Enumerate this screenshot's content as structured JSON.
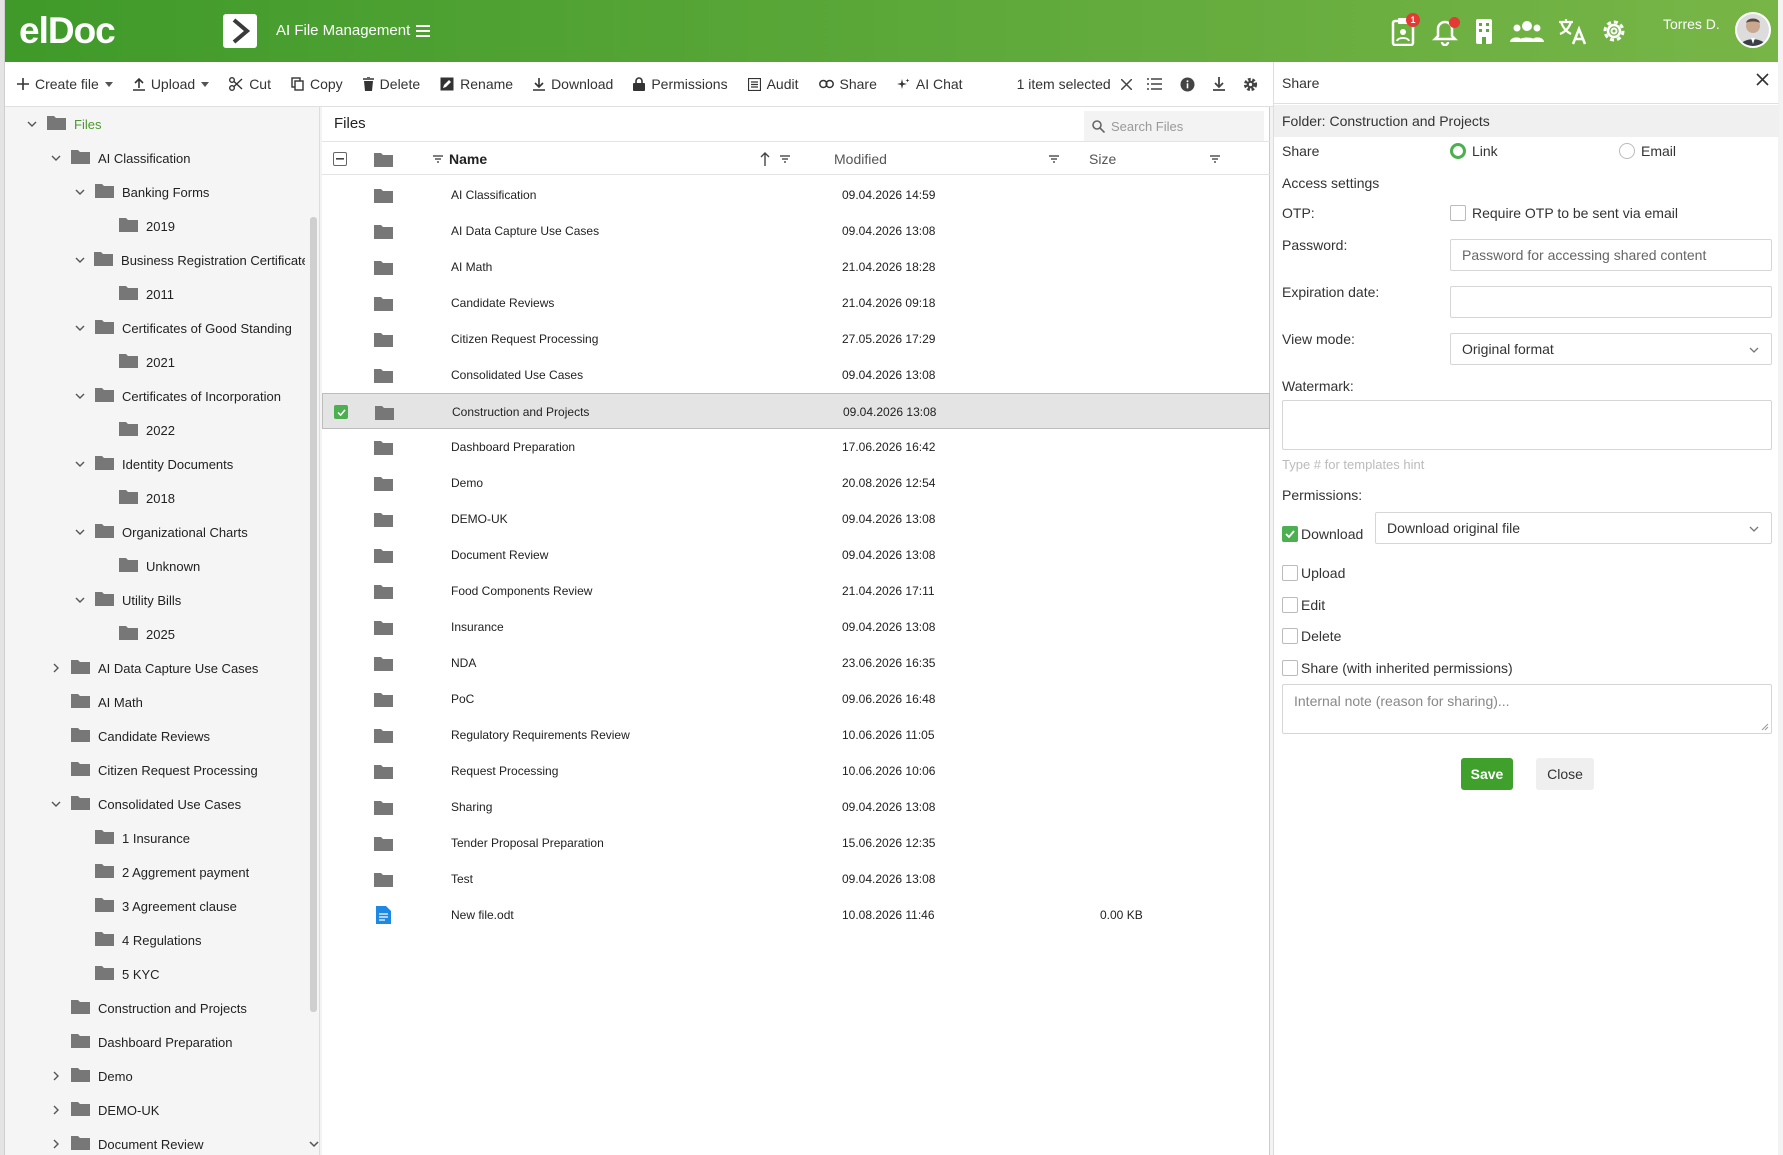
{
  "header": {
    "logo": "elDoc",
    "module_title": "AI File Management",
    "user_name": "Torres D.",
    "notification_badge": "1",
    "accent_color": "#5ea93a"
  },
  "toolbar": {
    "create_file": "Create file",
    "upload": "Upload",
    "cut": "Cut",
    "copy": "Copy",
    "delete": "Delete",
    "rename": "Rename",
    "download": "Download",
    "permissions": "Permissions",
    "audit": "Audit",
    "share": "Share",
    "ai_chat": "AI Chat",
    "selection": "1 item selected"
  },
  "tree": {
    "nodes": [
      {
        "label": "Files",
        "level": 0,
        "state": "expanded",
        "active": true
      },
      {
        "label": "AI Classification",
        "level": 1,
        "state": "expanded"
      },
      {
        "label": "Banking Forms",
        "level": 2,
        "state": "expanded"
      },
      {
        "label": "2019",
        "level": 3,
        "state": "leaf"
      },
      {
        "label": "Business Registration Certificates",
        "level": 2,
        "state": "expanded"
      },
      {
        "label": "2011",
        "level": 3,
        "state": "leaf"
      },
      {
        "label": "Certificates of Good Standing",
        "level": 2,
        "state": "expanded"
      },
      {
        "label": "2021",
        "level": 3,
        "state": "leaf"
      },
      {
        "label": "Certificates of Incorporation",
        "level": 2,
        "state": "expanded"
      },
      {
        "label": "2022",
        "level": 3,
        "state": "leaf"
      },
      {
        "label": "Identity Documents",
        "level": 2,
        "state": "expanded"
      },
      {
        "label": "2018",
        "level": 3,
        "state": "leaf"
      },
      {
        "label": "Organizational Charts",
        "level": 2,
        "state": "expanded"
      },
      {
        "label": "Unknown",
        "level": 3,
        "state": "leaf"
      },
      {
        "label": "Utility Bills",
        "level": 2,
        "state": "expanded"
      },
      {
        "label": "2025",
        "level": 3,
        "state": "leaf"
      },
      {
        "label": "AI Data Capture Use Cases",
        "level": 1,
        "state": "collapsed"
      },
      {
        "label": "AI Math",
        "level": 1,
        "state": "leaf"
      },
      {
        "label": "Candidate Reviews",
        "level": 1,
        "state": "leaf"
      },
      {
        "label": "Citizen Request Processing",
        "level": 1,
        "state": "leaf"
      },
      {
        "label": "Consolidated Use Cases",
        "level": 1,
        "state": "expanded"
      },
      {
        "label": "1 Insurance",
        "level": 2,
        "state": "leaf"
      },
      {
        "label": "2 Aggrement payment",
        "level": 2,
        "state": "leaf"
      },
      {
        "label": "3 Agreement clause",
        "level": 2,
        "state": "leaf"
      },
      {
        "label": "4 Regulations",
        "level": 2,
        "state": "leaf"
      },
      {
        "label": "5 KYC",
        "level": 2,
        "state": "leaf"
      },
      {
        "label": "Construction and Projects",
        "level": 1,
        "state": "leaf"
      },
      {
        "label": "Dashboard Preparation",
        "level": 1,
        "state": "leaf"
      },
      {
        "label": "Demo",
        "level": 1,
        "state": "collapsed"
      },
      {
        "label": "DEMO-UK",
        "level": 1,
        "state": "collapsed"
      },
      {
        "label": "Document Review",
        "level": 1,
        "state": "collapsed"
      }
    ]
  },
  "files": {
    "title": "Files",
    "search_placeholder": "Search Files",
    "columns": {
      "name": "Name",
      "modified": "Modified",
      "size": "Size"
    },
    "rows": [
      {
        "name": "AI Classification",
        "modified": "09.04.2026 14:59",
        "size": "",
        "type": "folder"
      },
      {
        "name": "AI Data Capture Use Cases",
        "modified": "09.04.2026 13:08",
        "size": "",
        "type": "folder"
      },
      {
        "name": "AI Math",
        "modified": "21.04.2026 18:28",
        "size": "",
        "type": "folder"
      },
      {
        "name": "Candidate Reviews",
        "modified": "21.04.2026 09:18",
        "size": "",
        "type": "folder"
      },
      {
        "name": "Citizen Request Processing",
        "modified": "27.05.2026 17:29",
        "size": "",
        "type": "folder"
      },
      {
        "name": "Consolidated Use Cases",
        "modified": "09.04.2026 13:08",
        "size": "",
        "type": "folder"
      },
      {
        "name": "Construction and Projects",
        "modified": "09.04.2026 13:08",
        "size": "",
        "type": "folder",
        "selected": true
      },
      {
        "name": "Dashboard Preparation",
        "modified": "17.06.2026 16:42",
        "size": "",
        "type": "folder"
      },
      {
        "name": "Demo",
        "modified": "20.08.2026 12:54",
        "size": "",
        "type": "folder"
      },
      {
        "name": "DEMO-UK",
        "modified": "09.04.2026 13:08",
        "size": "",
        "type": "folder"
      },
      {
        "name": "Document Review",
        "modified": "09.04.2026 13:08",
        "size": "",
        "type": "folder"
      },
      {
        "name": "Food Components Review",
        "modified": "21.04.2026 17:11",
        "size": "",
        "type": "folder"
      },
      {
        "name": "Insurance",
        "modified": "09.04.2026 13:08",
        "size": "",
        "type": "folder"
      },
      {
        "name": "NDA",
        "modified": "23.06.2026 16:35",
        "size": "",
        "type": "folder"
      },
      {
        "name": "PoC",
        "modified": "09.06.2026 16:48",
        "size": "",
        "type": "folder"
      },
      {
        "name": "Regulatory Requirements Review",
        "modified": "10.06.2026 11:05",
        "size": "",
        "type": "folder"
      },
      {
        "name": "Request Processing",
        "modified": "10.06.2026 10:06",
        "size": "",
        "type": "folder"
      },
      {
        "name": "Sharing",
        "modified": "09.04.2026 13:08",
        "size": "",
        "type": "folder"
      },
      {
        "name": "Tender Proposal Preparation",
        "modified": "15.06.2026 12:35",
        "size": "",
        "type": "folder"
      },
      {
        "name": "Test",
        "modified": "09.04.2026 13:08",
        "size": "",
        "type": "folder"
      },
      {
        "name": "New file.odt",
        "modified": "10.08.2026 11:46",
        "size": "0.00 KB",
        "type": "document"
      }
    ]
  },
  "share": {
    "title": "Share",
    "folder": "Folder: Construction and Projects",
    "share_label": "Share",
    "opt_link": "Link",
    "opt_email": "Email",
    "access_settings": "Access settings",
    "otp_label": "OTP:",
    "otp_checkbox": "Require OTP to be sent via email",
    "password_label": "Password:",
    "password_placeholder": "Password for accessing shared content",
    "expiration_label": "Expiration date:",
    "expiration_value": "",
    "viewmode_label": "View mode:",
    "viewmode_value": "Original format",
    "watermark_label": "Watermark:",
    "watermark_hint": "Type # for templates hint",
    "permissions_label": "Permissions:",
    "perm_download": "Download",
    "perm_download_option": "Download original file",
    "perm_upload": "Upload",
    "perm_edit": "Edit",
    "perm_delete": "Delete",
    "perm_share": "Share (with inherited permissions)",
    "note_placeholder": "Internal note (reason for sharing)...",
    "save": "Save",
    "close": "Close"
  }
}
